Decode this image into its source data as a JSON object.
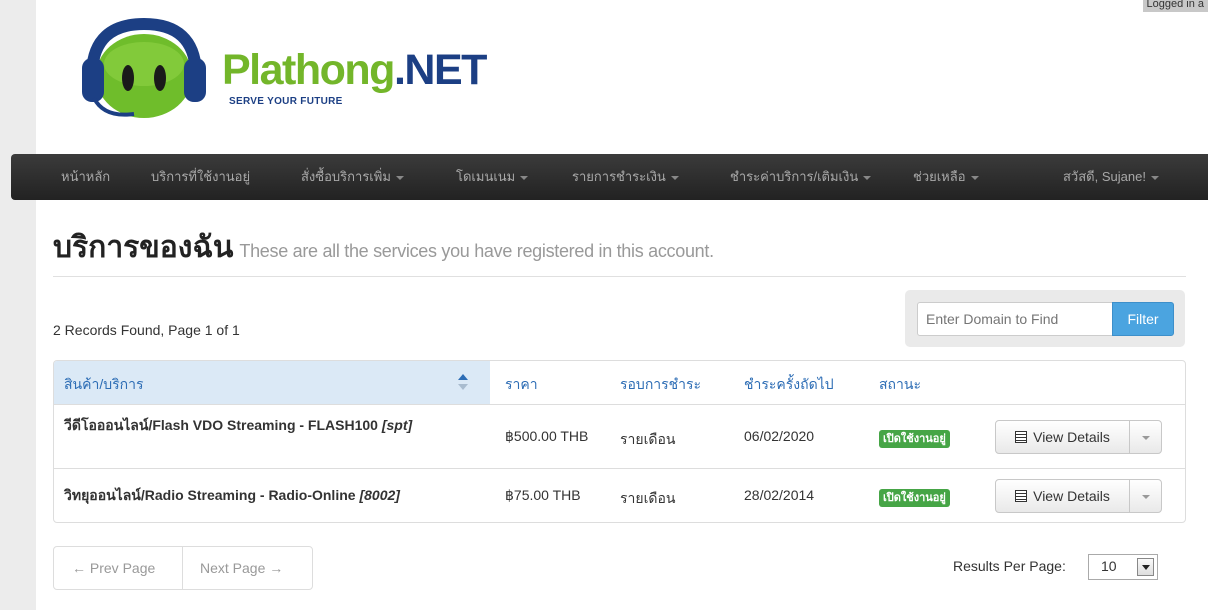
{
  "header": {
    "logged_in": "Logged in a",
    "logo_brand": "Plathong",
    "logo_suffix": ".NET",
    "logo_tagline": "SERVE YOUR FUTURE"
  },
  "navbar": {
    "items": [
      {
        "label": "หน้าหลัก"
      },
      {
        "label": "บริการที่ใช้งานอยู่"
      },
      {
        "label": "สั่งซื้อบริการเพิ่ม"
      },
      {
        "label": "โดเมนเนม"
      },
      {
        "label": "รายการชำระเงิน"
      },
      {
        "label": "ชำระค่าบริการ/เติมเงิน"
      },
      {
        "label": "ช่วยเหลือ"
      },
      {
        "label": "สวัสดี, Sujane!"
      }
    ]
  },
  "page": {
    "title": "บริการของฉัน",
    "subtitle": "These are all the services you have registered in this account.",
    "records_found": "2 Records Found, Page 1 of 1"
  },
  "filter": {
    "placeholder": "Enter Domain to Find",
    "button_label": "Filter"
  },
  "table": {
    "headers": {
      "product": "สินค้า/บริการ",
      "price": "ราคา",
      "cycle": "รอบการชำระ",
      "next_due": "ชำระครั้งถัดไป",
      "status": "สถานะ"
    },
    "rows": [
      {
        "product": "วีดีโอออนไลน์/Flash VDO Streaming - FLASH100",
        "tag": "[spt]",
        "price": "฿500.00 THB",
        "cycle": "รายเดือน",
        "next_due": "06/02/2020",
        "status": "เปิดใช้งานอยู่",
        "action": "View Details"
      },
      {
        "product": "วิทยุออนไลน์/Radio Streaming - Radio-Online",
        "tag": "[8002]",
        "price": "฿75.00 THB",
        "cycle": "รายเดือน",
        "next_due": "28/02/2014",
        "status": "เปิดใช้งานอยู่",
        "action": "View Details"
      }
    ]
  },
  "pagination": {
    "prev": "← Prev Page",
    "next": "Next Page →",
    "results_per_page_label": "Results Per Page:",
    "results_per_page_value": "10"
  },
  "colors": {
    "brand_green": "#73b62a",
    "brand_blue": "#1c3f84",
    "status_green": "#46a546",
    "link_blue": "#2d6db5",
    "filter_button": "#4ba4e0",
    "navbar": "#2a2a2a"
  }
}
